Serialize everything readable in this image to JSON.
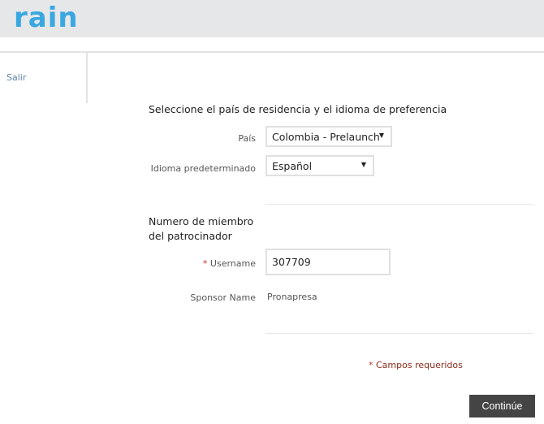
{
  "header": {
    "logo": "rain"
  },
  "sidebar": {
    "logout": "Salir"
  },
  "form": {
    "section_title": "Seleccione el país de residencia y el idioma de preferencia",
    "country_label": "País",
    "country_value": "Colombia - Prelaunch",
    "language_label": "Idioma predeterminado",
    "language_value": "Español",
    "sponsor_title_1": "Numero de miembro",
    "sponsor_title_2": "del patrocinador",
    "required_mark": "*",
    "username_label": "Username",
    "username_value": "307709",
    "sponsor_name_label": "Sponsor Name",
    "sponsor_name_value": "Pronapresa",
    "required_note": "Campos requeridos",
    "continue_label": "Continúe"
  },
  "colors": {
    "brand": "#3aa8e0",
    "required": "#c0392b",
    "button": "#444444"
  }
}
